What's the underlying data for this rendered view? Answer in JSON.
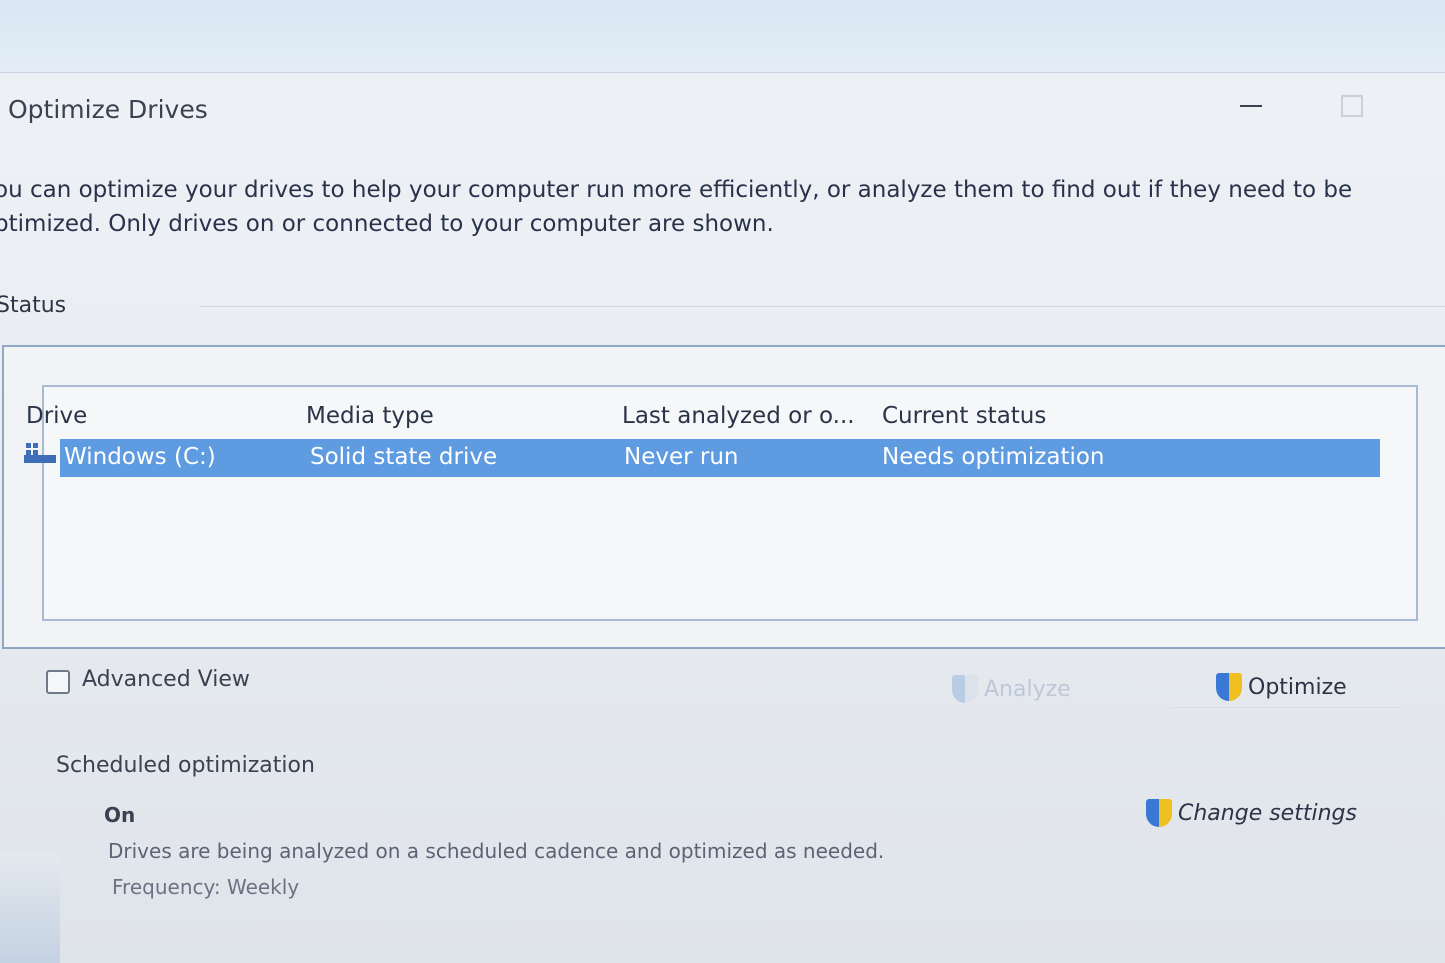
{
  "window": {
    "title": "Optimize Drives"
  },
  "description": "ou can optimize your drives to help your computer run more efficiently, or analyze them to find out if they need to be ptimized. Only drives on or connected to your computer are shown.",
  "status": {
    "label": "Status",
    "columns": [
      "Drive",
      "Media type",
      "Last analyzed or o...",
      "Current status"
    ],
    "rows": [
      {
        "drive": "Windows (C:)",
        "media_type": "Solid state drive",
        "last_analyzed": "Never run",
        "current_status": "Needs optimization",
        "selected": true
      }
    ]
  },
  "advanced_view": {
    "label": "Advanced View",
    "checked": false
  },
  "buttons": {
    "analyze": "Analyze",
    "optimize": "Optimize",
    "change_settings": "Change settings"
  },
  "scheduled": {
    "title": "Scheduled optimization",
    "status": "On",
    "description": "Drives are being analyzed on a scheduled cadence and optimized as needed.",
    "frequency": "Frequency: Weekly"
  },
  "colors": {
    "selection": "#5e9be0",
    "shield_blue": "#3a78d6",
    "shield_yellow": "#f0c020"
  }
}
